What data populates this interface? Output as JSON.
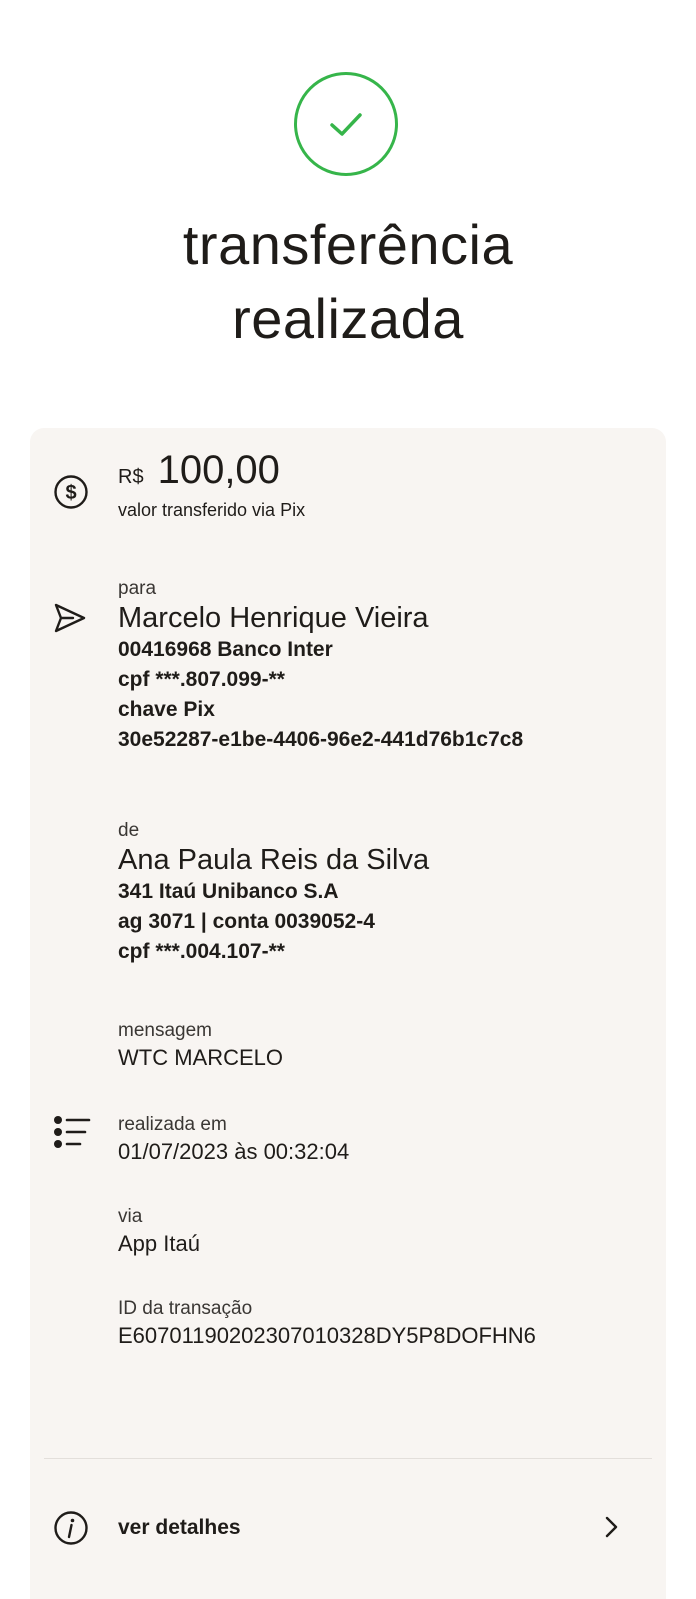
{
  "status": {
    "title_line1": "transferência",
    "title_line2": "realizada",
    "icon": "check-circle-icon",
    "icon_color": "#36b54a"
  },
  "amount": {
    "currency": "R$",
    "value": "100,00",
    "caption": "valor transferido via Pix",
    "icon": "dollar-circle-icon"
  },
  "recipient": {
    "label": "para",
    "name": "Marcelo Henrique Vieira",
    "bank": "00416968 Banco Inter",
    "cpf": "cpf ***.807.099-**",
    "key_label": "chave Pix",
    "key_value": "30e52287-e1be-4406-96e2-441d76b1c7c8",
    "icon": "send-icon"
  },
  "sender": {
    "label": "de",
    "name": "Ana Paula Reis da Silva",
    "bank": "341 Itaú Unibanco S.A",
    "account": "ag 3071 | conta 0039052-4",
    "cpf": "cpf ***.004.107-**"
  },
  "message": {
    "label": "mensagem",
    "value": "WTC MARCELO"
  },
  "datetime": {
    "label": "realizada em",
    "value": "01/07/2023 às 00:32:04",
    "icon": "list-icon"
  },
  "channel": {
    "label": "via",
    "value": "App Itaú"
  },
  "transaction": {
    "label": "ID da transação",
    "value": "E60701190202307010328DY5P8DOFHN6"
  },
  "details": {
    "label": "ver detalhes",
    "icon": "info-icon",
    "arrow_icon": "chevron-right-icon"
  },
  "colors": {
    "card_background": "#f8f5f2",
    "text": "#1f1c19",
    "success": "#36b54a"
  }
}
